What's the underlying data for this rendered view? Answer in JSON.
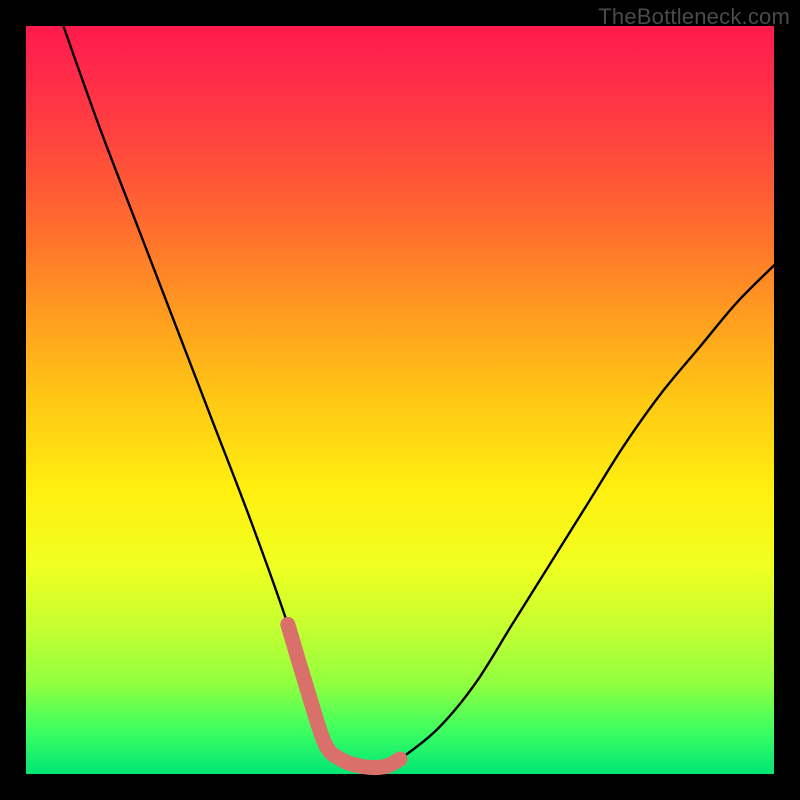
{
  "watermark": "TheBottleneck.com",
  "chart_data": {
    "type": "line",
    "title": "",
    "xlabel": "",
    "ylabel": "",
    "xlim": [
      0,
      100
    ],
    "ylim": [
      0,
      100
    ],
    "series": [
      {
        "name": "bottleneck-curve",
        "x": [
          5,
          10,
          15,
          20,
          25,
          30,
          35,
          38,
          40,
          42,
          45,
          48,
          50,
          55,
          60,
          65,
          70,
          75,
          80,
          85,
          90,
          95,
          100
        ],
        "y": [
          100,
          86,
          73,
          60,
          47,
          34,
          20,
          10,
          4,
          2,
          1,
          1,
          2,
          6,
          12,
          20,
          28,
          36,
          44,
          51,
          57,
          63,
          68
        ]
      }
    ],
    "highlight_segment": {
      "x": [
        35,
        38,
        40,
        42,
        45,
        48,
        50
      ],
      "y": [
        20,
        10,
        4,
        2,
        1,
        1,
        2,
        6
      ]
    },
    "colors": {
      "curve": "#000000",
      "highlight": "#d9706a"
    }
  }
}
